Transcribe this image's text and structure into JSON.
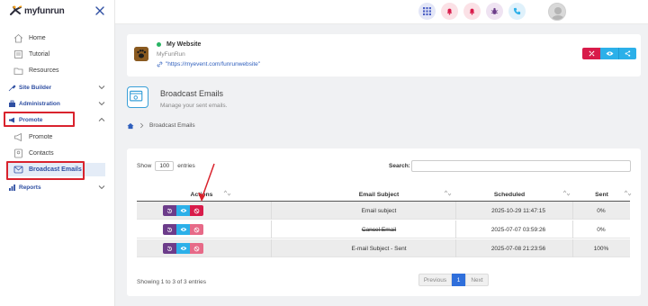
{
  "brand": {
    "name": "myfunrun"
  },
  "sidebar": {
    "items": [
      {
        "label": "Home",
        "icon": "home-icon"
      },
      {
        "label": "Tutorial",
        "icon": "book-icon"
      },
      {
        "label": "Resources",
        "icon": "folder-icon"
      },
      {
        "label": "Site Builder",
        "icon": "tools-icon"
      },
      {
        "label": "Administration",
        "icon": "admin-icon"
      },
      {
        "label": "Promote",
        "icon": "megaphone-icon"
      },
      {
        "label": "Promote",
        "icon": "megaphone-icon"
      },
      {
        "label": "Contacts",
        "icon": "contacts-icon"
      },
      {
        "label": "Broadcast Emails",
        "icon": "broadcast-icon"
      },
      {
        "label": "Reports",
        "icon": "chart-icon"
      }
    ]
  },
  "site": {
    "name": "My Website",
    "org": "MyFunRun",
    "url": "\"https://myevent.com/funrunwebsite\""
  },
  "page": {
    "title": "Broadcast Emails",
    "subtitle": "Manage your sent emails.",
    "breadcrumb": "Broadcast Emails"
  },
  "table": {
    "show_label": "Show",
    "entries_value": "100",
    "entries_label": "entries",
    "search_label": "Search:",
    "columns": [
      "Actions",
      "Email Subject",
      "Scheduled",
      "Sent"
    ],
    "rows": [
      {
        "subject": "Email subject",
        "scheduled": "2025-10-29 11:47:15",
        "sent": "0%"
      },
      {
        "subject": "Cancel Email",
        "scheduled": "2025-07-07 03:59:26",
        "sent": "0%"
      },
      {
        "subject": "E-mail Subject - Sent",
        "scheduled": "2025-07-08 21:23:56",
        "sent": "100%"
      }
    ],
    "info": "Showing 1 to 3 of 3 entries",
    "pager": {
      "previous": "Previous",
      "current": "1",
      "next": "Next"
    }
  },
  "colors": {
    "accent": "#2f4fa2",
    "highlight": "#d9232d",
    "purple": "#6c3c8a",
    "blue": "#2cb0e9",
    "red": "#d81b4a"
  }
}
